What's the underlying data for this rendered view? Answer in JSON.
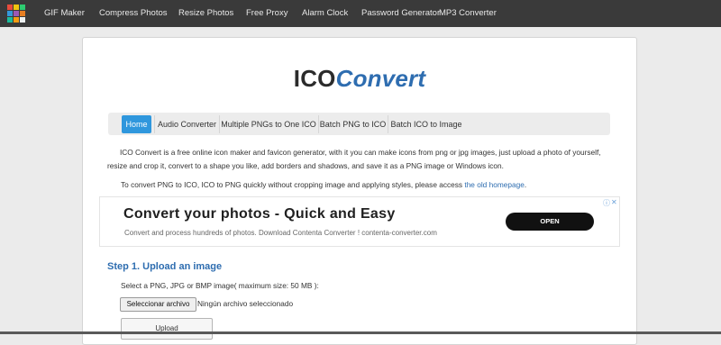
{
  "topbar": {
    "nav": [
      "GIF Maker",
      "Compress Photos",
      "Resize Photos",
      "Free Proxy",
      "Alarm Clock",
      "Password Generator",
      "MP3 Converter"
    ]
  },
  "brand": {
    "part1": "ICO",
    "part2": "Convert"
  },
  "navbar": {
    "items": [
      "Home",
      "Audio Converter",
      "Multiple PNGs to One ICO",
      "Batch PNG to ICO",
      "Batch ICO to Image"
    ],
    "active": "Home"
  },
  "intro": {
    "paragraph": "ICO Convert is a free online icon maker and favicon generator, with it you can make icons from png or jpg images, just upload a photo of yourself, resize and crop it, convert to a shape you like, add borders and shadows, and save it as a PNG image or Windows icon.",
    "line2_text": "To convert PNG to ICO, ICO to PNG quickly without cropping image and applying styles, please access",
    "line2_link": "the old homepage",
    "line2_end": "."
  },
  "ad": {
    "title": "Convert your photos - Quick and Easy",
    "subtitle": "Convert and process hundreds of photos. Download Contenta Converter ! contenta-converter.com",
    "button": "OPEN",
    "info_icon": "info-icon",
    "close_icon": "close-icon"
  },
  "upload": {
    "step_title": "Step 1. Upload an image",
    "select_label": "Select a PNG, JPG or BMP image( maximum size: 50 MB ):",
    "file_button": "Seleccionar archivo",
    "file_status": "Ningún archivo seleccionado",
    "upload_button": "Upload"
  },
  "colors": {
    "topbar": "#3a3a3a",
    "accent": "#2e6db0",
    "active_tab": "#2f97dd"
  }
}
